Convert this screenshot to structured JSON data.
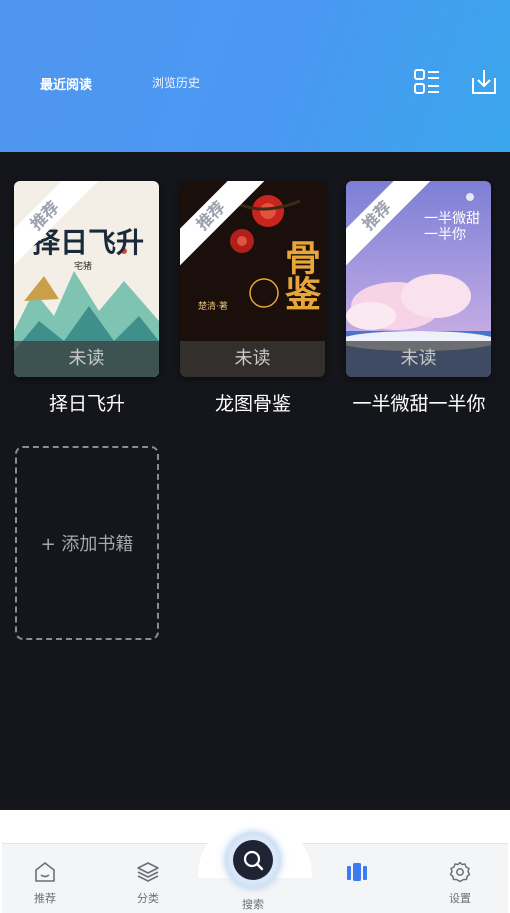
{
  "header": {
    "tab_recent": "最近阅读",
    "tab_history": "浏览历史",
    "list_icon": "list-grid-icon",
    "download_icon": "download-icon"
  },
  "books": [
    {
      "title": "择日飞升",
      "badge": "推荐",
      "status": "未读",
      "cover_text": "择日飞升",
      "author": "宅猪"
    },
    {
      "title": "龙图骨鉴",
      "badge": "推荐",
      "status": "未读",
      "cover_text": "骨鉴",
      "author": "楚清·著"
    },
    {
      "title": "一半微甜一半你",
      "badge": "推荐",
      "status": "未读",
      "cover_text": "一半微甜一半你"
    }
  ],
  "add_book": "+ 添加书籍",
  "nav": {
    "recommend": "推荐",
    "category": "分类",
    "search": "搜索",
    "bookshelf": "",
    "settings": "设置"
  },
  "colors": {
    "header": "#4a98f2",
    "background": "#15161b",
    "accent": "#3d7cf0"
  }
}
